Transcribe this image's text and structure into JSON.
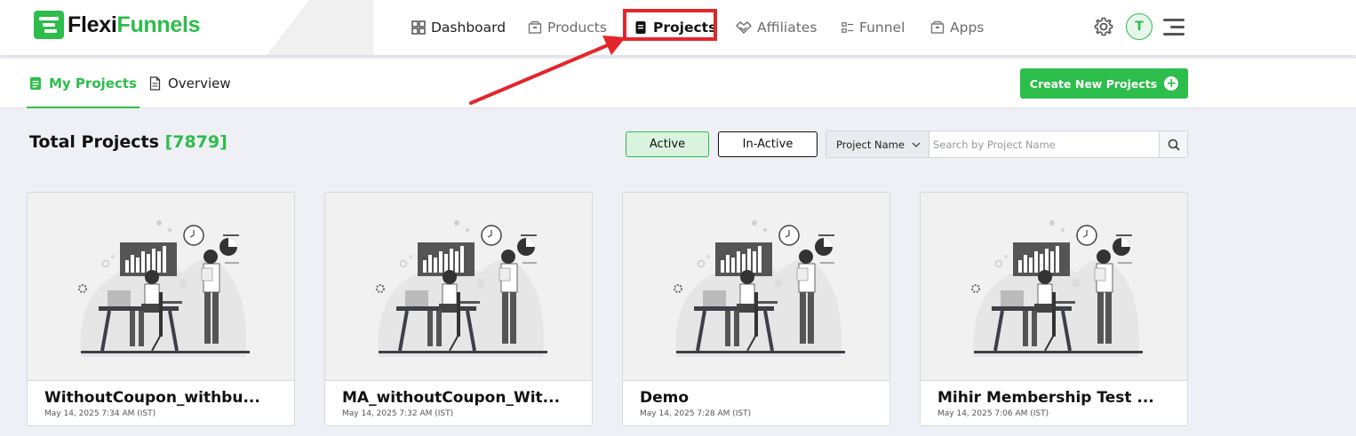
{
  "brand": {
    "name_part1": "Flexi",
    "name_part2": "Funnels"
  },
  "nav": [
    {
      "label": "Dashboard"
    },
    {
      "label": "Products"
    },
    {
      "label": "Projects"
    },
    {
      "label": "Affiliates"
    },
    {
      "label": "Funnel"
    },
    {
      "label": "Apps"
    }
  ],
  "user": {
    "avatar_initial": "T"
  },
  "subtabs": {
    "my_projects": "My Projects",
    "overview": "Overview"
  },
  "create_button": "Create New Projects",
  "total": {
    "label": "Total Projects",
    "count": "[7879]"
  },
  "filters": {
    "active": "Active",
    "inactive": "In-Active"
  },
  "search": {
    "select_value": "Project Name",
    "placeholder": "Search by Project Name"
  },
  "projects": [
    {
      "title": "WithoutCoupon_withbu...",
      "date": "May 14, 2025 7:34 AM (IST)"
    },
    {
      "title": "MA_withoutCoupon_Wit...",
      "date": "May 14, 2025 7:32 AM (IST)"
    },
    {
      "title": "Demo",
      "date": "May 14, 2025 7:28 AM (IST)"
    },
    {
      "title": "Mihir Membership Test ...",
      "date": "May 14, 2025 7:06 AM (IST)"
    }
  ],
  "colors": {
    "accent": "#2dbd4b",
    "highlight": "#e3262b"
  },
  "icons": [
    "dashboard-icon",
    "products-icon",
    "projects-icon",
    "affiliates-icon",
    "funnel-icon",
    "apps-icon",
    "gear-icon",
    "menu-icon",
    "search-icon",
    "plus-icon",
    "document-icon"
  ]
}
